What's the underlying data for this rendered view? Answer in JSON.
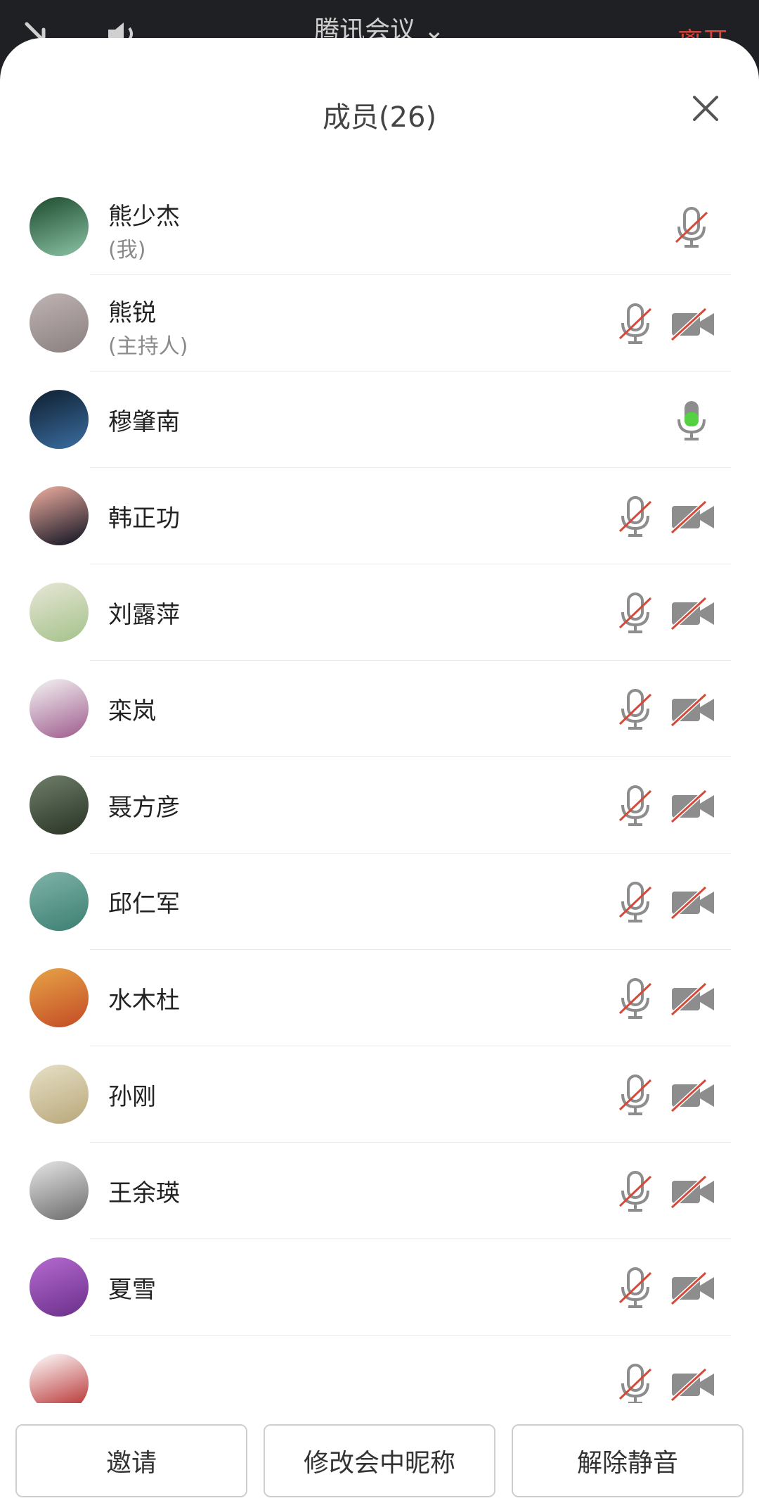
{
  "topbar": {
    "title": "腾讯会议",
    "leave": "离开"
  },
  "sheet": {
    "title": "成员(26)"
  },
  "members": [
    {
      "name": "熊少杰",
      "sub": "(我)",
      "mic": "muted",
      "cam": false,
      "avatar": [
        "#1d4a2d",
        "#8bc3a6"
      ]
    },
    {
      "name": "熊锐",
      "sub": "(主持人)",
      "mic": "muted",
      "cam": true,
      "avatar": [
        "#bfb3b3",
        "#8a7f7f"
      ]
    },
    {
      "name": "穆肇南",
      "sub": "",
      "mic": "active",
      "cam": false,
      "avatar": [
        "#0e1e2e",
        "#3b6ea2"
      ]
    },
    {
      "name": "韩正功",
      "sub": "",
      "mic": "muted",
      "cam": true,
      "avatar": [
        "#f1b0a1",
        "#0c1020"
      ]
    },
    {
      "name": "刘露萍",
      "sub": "",
      "mic": "muted",
      "cam": true,
      "avatar": [
        "#e7e7d6",
        "#a4c18a"
      ]
    },
    {
      "name": "栾岚",
      "sub": "",
      "mic": "muted",
      "cam": true,
      "avatar": [
        "#f4f4f4",
        "#9e5a8c"
      ]
    },
    {
      "name": "聂方彦",
      "sub": "",
      "mic": "muted",
      "cam": true,
      "avatar": [
        "#6f7f6a",
        "#283224"
      ]
    },
    {
      "name": "邱仁军",
      "sub": "",
      "mic": "muted",
      "cam": true,
      "avatar": [
        "#80b3a8",
        "#3c7f72"
      ]
    },
    {
      "name": "水木杜",
      "sub": "",
      "mic": "muted",
      "cam": true,
      "avatar": [
        "#e6a347",
        "#c44b25"
      ]
    },
    {
      "name": "孙刚",
      "sub": "",
      "mic": "muted",
      "cam": true,
      "avatar": [
        "#e6e0c6",
        "#b9a77a"
      ]
    },
    {
      "name": "王余瑛",
      "sub": "",
      "mic": "muted",
      "cam": true,
      "avatar": [
        "#e6e6e6",
        "#6a6a6a"
      ]
    },
    {
      "name": "夏雪",
      "sub": "",
      "mic": "muted",
      "cam": true,
      "avatar": [
        "#b56ad0",
        "#6a2f8a"
      ]
    },
    {
      "name": "",
      "sub": "",
      "mic": "muted",
      "cam": true,
      "avatar": [
        "#ffffff",
        "#b22222"
      ]
    }
  ],
  "footer": {
    "invite": "邀请",
    "rename": "修改会中昵称",
    "unmute": "解除静音"
  },
  "colors": {
    "leave_red": "#e0443a",
    "icon_gray": "#8d8d8d",
    "strike_red": "#d44a3a",
    "mic_green": "#55d142"
  },
  "icons": {
    "back": "minimize-icon",
    "speaker": "speaker-icon",
    "chevron": "chevron-down-icon",
    "close": "close-icon",
    "mic_muted": "mic-muted-icon",
    "mic_active": "mic-active-icon",
    "cam_off": "camera-off-icon"
  }
}
